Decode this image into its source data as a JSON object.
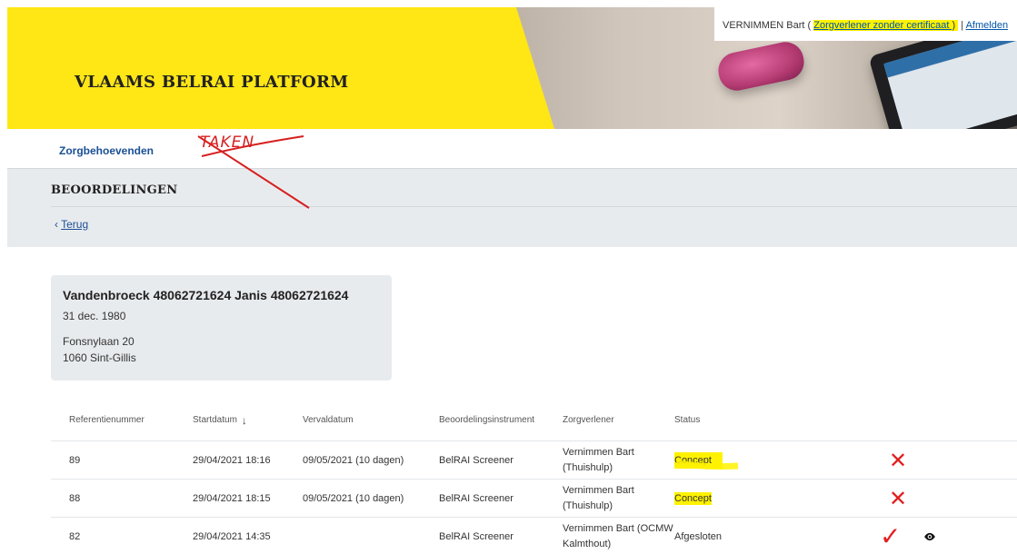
{
  "header": {
    "brand": "VLAAMS BELRAI PLATFORM",
    "user_name": "VERNIMMEN Bart",
    "open_paren": " ( ",
    "role": "Zorgverlener zonder certificaat ",
    "close_paren": ")",
    "separator": " | ",
    "logout": "Afmelden"
  },
  "nav": {
    "patients": "Zorgbehoevenden",
    "tasks_annotation": "TAKEN"
  },
  "page": {
    "title": "BEOORDELINGEN",
    "back_label": "Terug",
    "back_icon": "‹"
  },
  "patient": {
    "name": "Vandenbroeck 48062721624 Janis 48062721624",
    "birth_date": "31 dec. 1980",
    "address_street": "Fonsnylaan 20",
    "address_city": "1060 Sint-Gillis"
  },
  "table": {
    "columns": {
      "reference": "Referentienummer",
      "start": "Startdatum",
      "sort_icon": "↓",
      "expiry": "Vervaldatum",
      "instrument": "Beoordelingsinstrument",
      "caregiver": "Zorgverlener",
      "status": "Status"
    },
    "rows": [
      {
        "reference": "89",
        "start": "29/04/2021 18:16",
        "expiry": "09/05/2021 (10 dagen)",
        "instrument": "BelRAI Screener",
        "caregiver": "Vernimmen Bart (Thuishulp)",
        "status": "Concept",
        "mark": "✕"
      },
      {
        "reference": "88",
        "start": "29/04/2021 18:15",
        "expiry": "09/05/2021 (10 dagen)",
        "instrument": "BelRAI Screener",
        "caregiver": "Vernimmen Bart (Thuishulp)",
        "status": "Concept",
        "mark": "✕"
      },
      {
        "reference": "82",
        "start": "29/04/2021 14:35",
        "expiry": "",
        "instrument": "BelRAI Screener",
        "caregiver": "Vernimmen Bart (OCMW Kalmthout)",
        "status": "Afgesloten",
        "mark": "✓"
      }
    ]
  },
  "colors": {
    "brand_yellow": "#ffe615",
    "highlight": "#fff200",
    "link_blue": "#1a4f95",
    "annotation_red": "#e02020"
  }
}
